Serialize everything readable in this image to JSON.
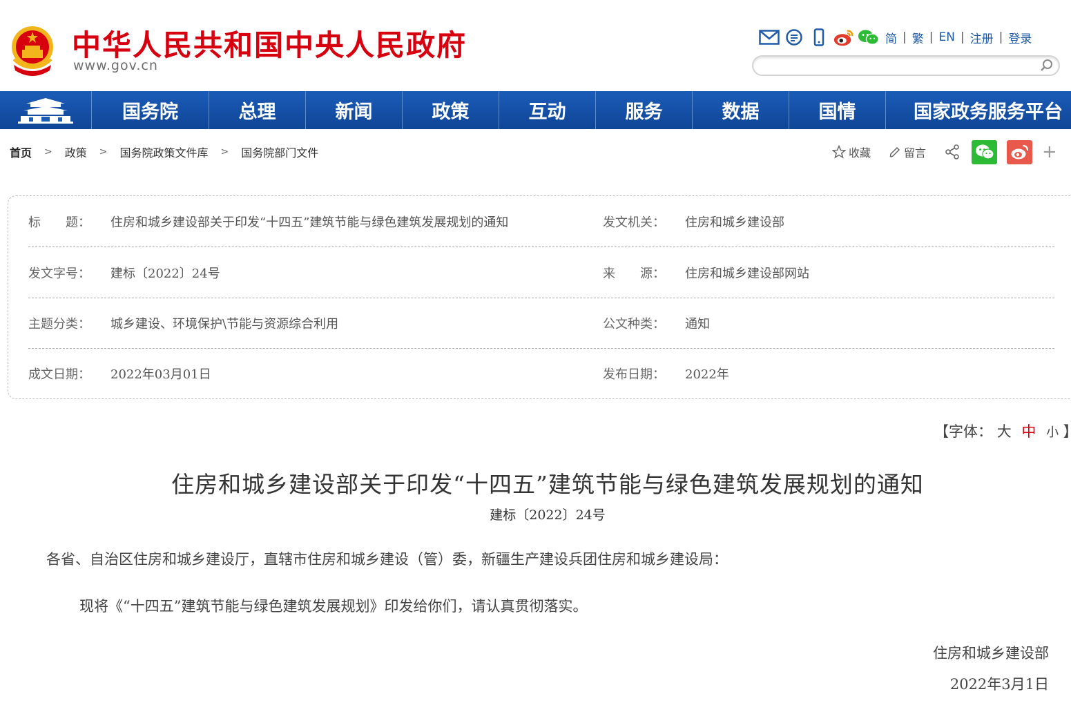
{
  "header": {
    "site_title": "中华人民共和国中央人民政府",
    "site_url": "www.gov.cn",
    "lang_links": [
      "简",
      "繁",
      "EN",
      "注册",
      "登录"
    ],
    "search_placeholder": ""
  },
  "nav": {
    "items": [
      "国务院",
      "总理",
      "新闻",
      "政策",
      "互动",
      "服务",
      "数据",
      "国情",
      "国家政务服务平台"
    ]
  },
  "breadcrumb": {
    "items": [
      "首页",
      "政策",
      "国务院政策文件库",
      "国务院部门文件"
    ]
  },
  "share": {
    "favorite": "收藏",
    "comment": "留言",
    "plus": "+"
  },
  "info": {
    "title_label": "标　　题：",
    "title_value": "住房和城乡建设部关于印发“十四五”建筑节能与绿色建筑发展规划的通知",
    "issuer_label": "发文机关：",
    "issuer_value": "住房和城乡建设部",
    "docno_label": "发文字号：",
    "docno_value": "建标〔2022〕24号",
    "source_label": "来　　源：",
    "source_value": "住房和城乡建设部网站",
    "category_label": "主题分类：",
    "category_value": "城乡建设、环境保护\\节能与资源综合利用",
    "type_label": "公文种类：",
    "type_value": "通知",
    "written_label": "成文日期：",
    "written_value": "2022年03月01日",
    "publish_label": "发布日期：",
    "publish_value": "2022年"
  },
  "font_size": {
    "prefix": "【字体：",
    "large": "大",
    "medium": "中",
    "small": "小",
    "suffix": "】"
  },
  "article": {
    "title": "住房和城乡建设部关于印发“十四五”建筑节能与绿色建筑发展规划的通知",
    "doc_number": "建标〔2022〕24号",
    "salutation": "各省、自治区住房和城乡建设厅，直辖市住房和城乡建设（管）委，新疆生产建设兵团住房和城乡建设局：",
    "paragraph": "现将《“十四五”建筑节能与绿色建筑发展规划》印发给你们，请认真贯彻落实。",
    "signer": "住房和城乡建设部",
    "date": "2022年3月1日"
  },
  "colors": {
    "brand_red": "#d7000f",
    "nav_blue": "#1b5cb8",
    "link_blue": "#1f5aa8",
    "wechat_green": "#2dbb35",
    "weibo_red": "#e8584b"
  }
}
